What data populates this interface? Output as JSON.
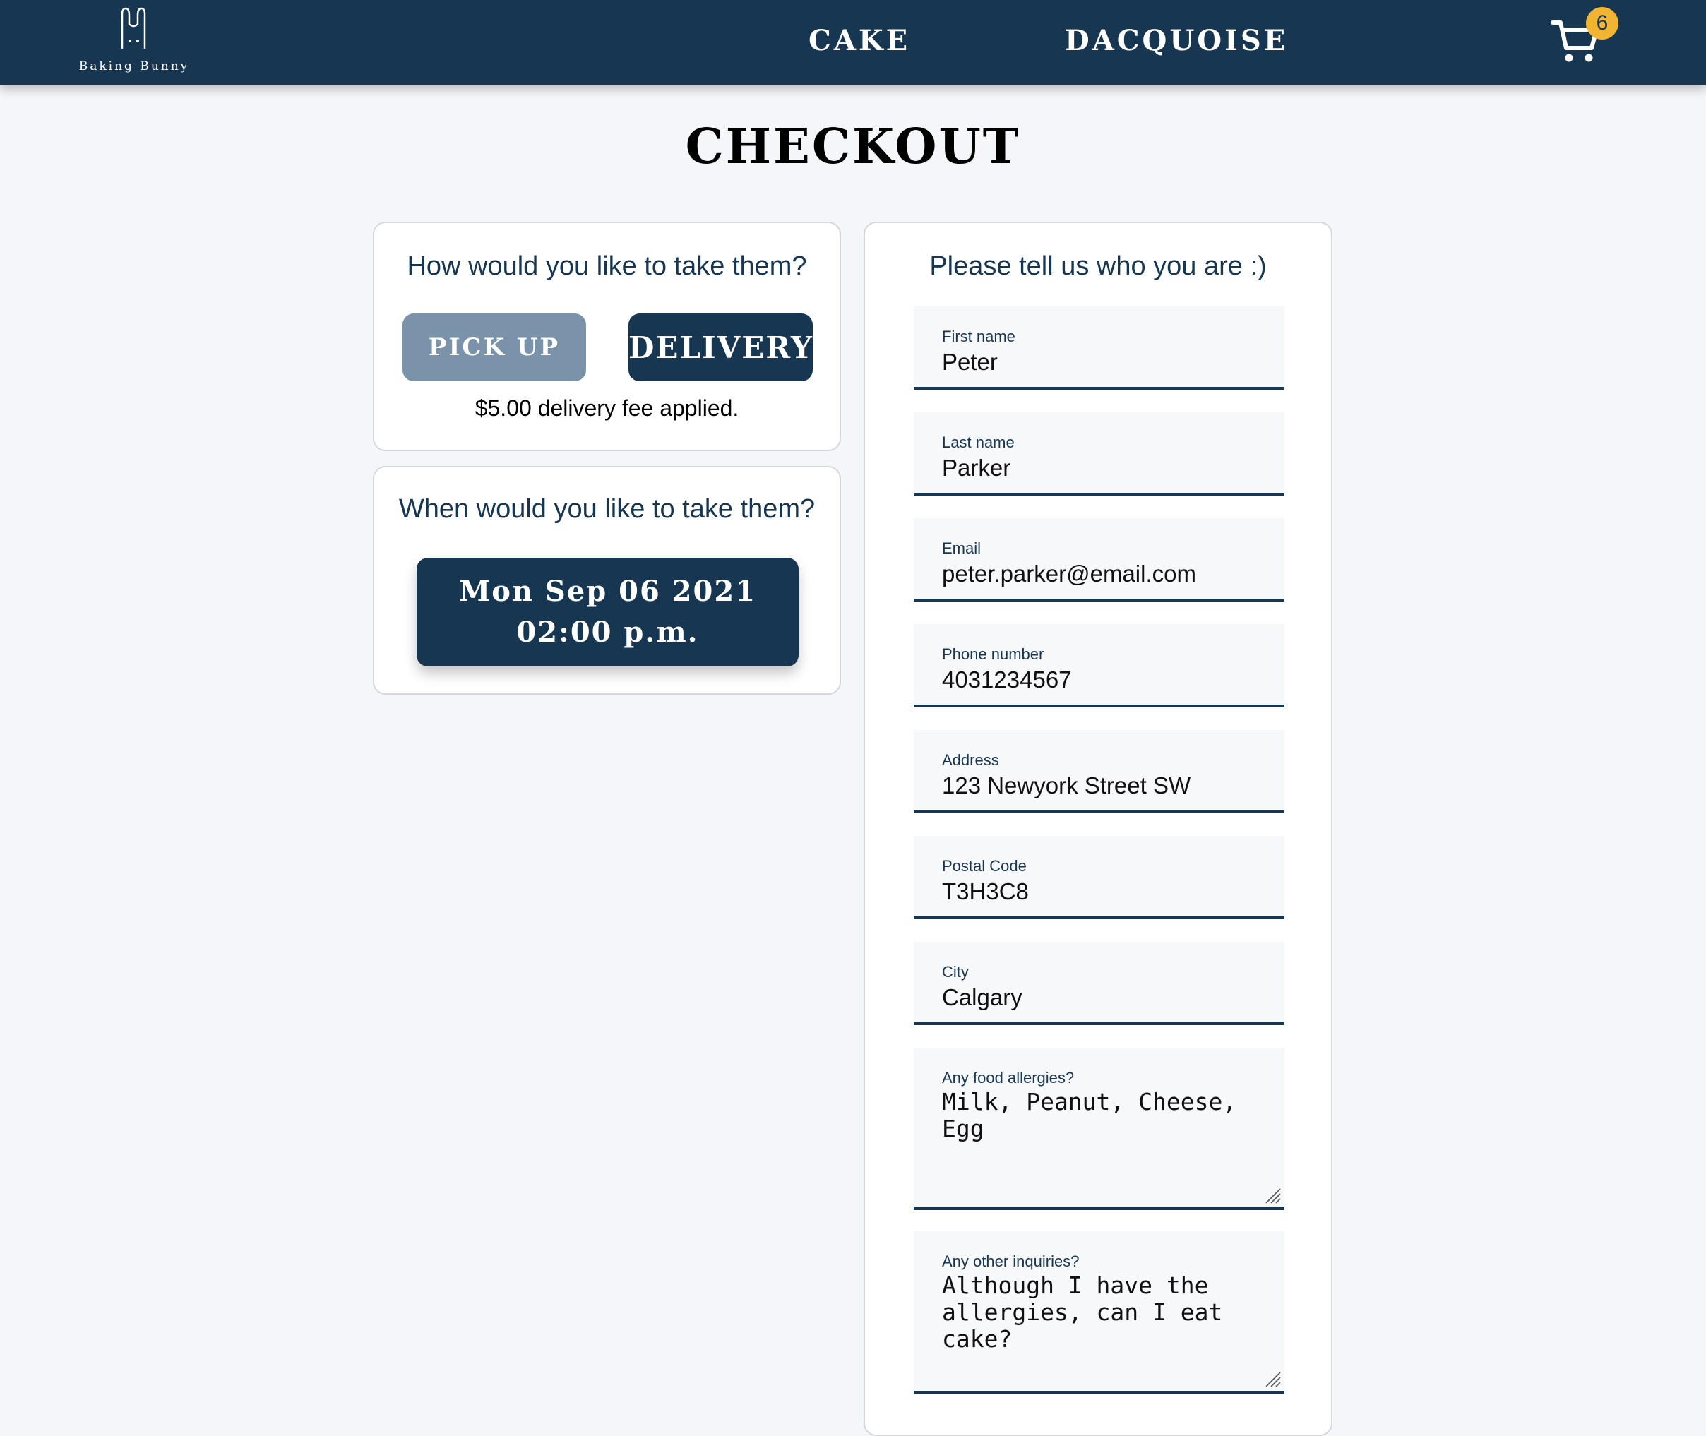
{
  "header": {
    "logo_text": "Baking Bunny",
    "nav": [
      {
        "label": "CAKE"
      },
      {
        "label": "DACQUOISE"
      }
    ],
    "cart_count": "6",
    "icons": {
      "logo": "bunny-logo-icon",
      "cart": "shopping-cart-icon"
    }
  },
  "page": {
    "title": "CHECKOUT"
  },
  "delivery_method": {
    "heading": "How would you like to take them?",
    "options": [
      {
        "label": "PICK UP",
        "selected": false
      },
      {
        "label": "DELIVERY",
        "selected": true
      }
    ],
    "fee_note": "$5.00 delivery fee applied."
  },
  "schedule": {
    "heading": "When would you like to take them?",
    "date": "Mon Sep 06 2021",
    "time": "02:00 p.m."
  },
  "customer": {
    "heading": "Please tell us who you are :)",
    "fields": [
      {
        "label": "First name",
        "value": "Peter"
      },
      {
        "label": "Last name",
        "value": "Parker"
      },
      {
        "label": "Email",
        "value": "peter.parker@email.com"
      },
      {
        "label": "Phone number",
        "value": "4031234567"
      },
      {
        "label": "Address",
        "value": "123 Newyork Street SW"
      },
      {
        "label": "Postal Code",
        "value": "T3H3C8"
      },
      {
        "label": "City",
        "value": "Calgary"
      },
      {
        "label": "Any food allergies?",
        "value": "Milk, Peanut, Cheese, Egg"
      },
      {
        "label": "Any other inquiries?",
        "value": "Although I have the allergies, can I eat cake?"
      }
    ]
  },
  "colors": {
    "navy": "#163651",
    "muted_blue": "#7a93aa",
    "badge": "#f2b531",
    "background": "#f5f6f9"
  }
}
